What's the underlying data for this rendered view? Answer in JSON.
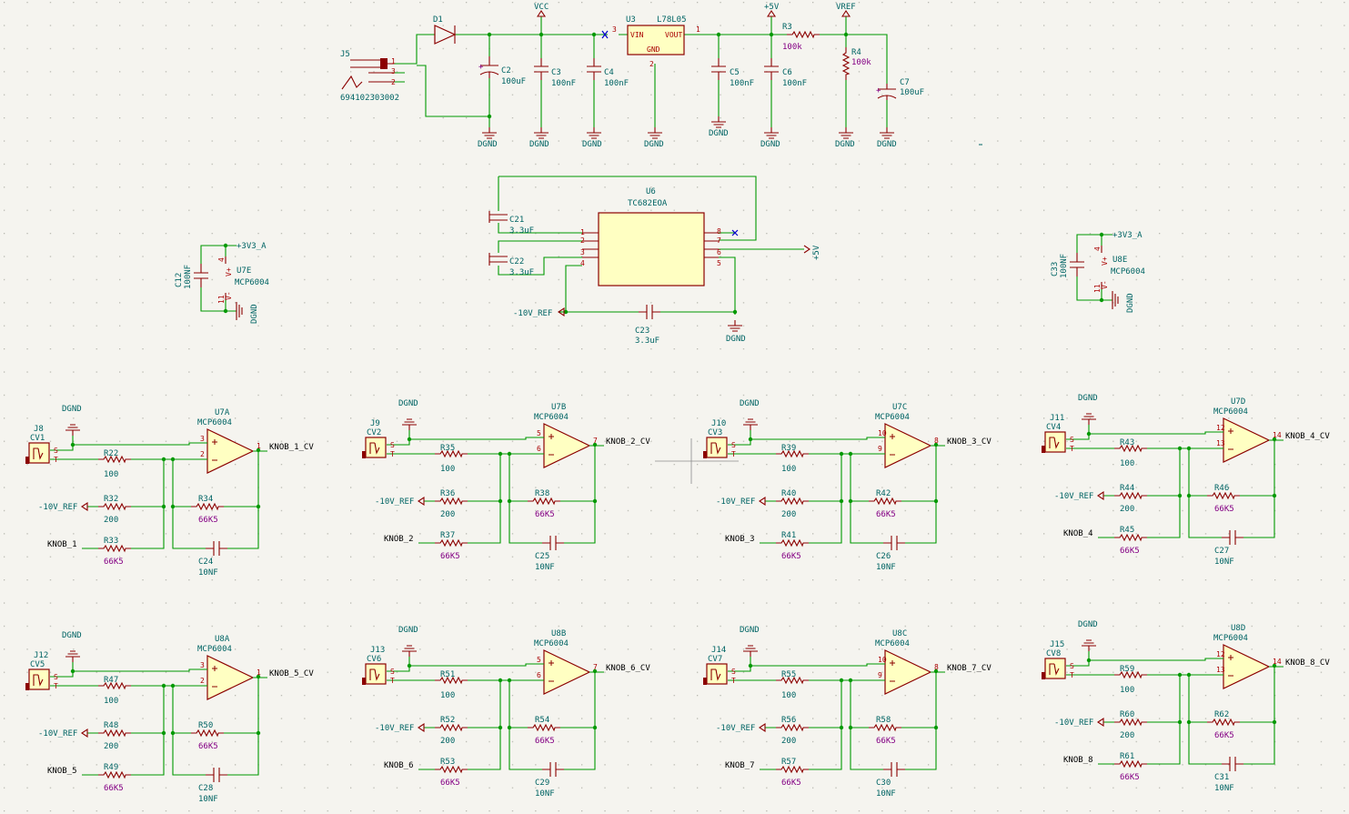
{
  "colors": {
    "wire": "#009900",
    "body": "#8b0000",
    "fill": "#ffffc2",
    "text": "#006464",
    "value": "#840084",
    "pin": "#a90000",
    "bg": "#f5f4ef"
  },
  "power": {
    "jack_ref": "J5",
    "jack_part": "694102303002",
    "jack_pins": [
      "1",
      "3",
      "2"
    ],
    "d1": "D1",
    "vcc": "VCC",
    "p5v": "+5V",
    "vref": "VREF",
    "c2": "C2",
    "c2v": "100uF",
    "c3": "C3",
    "c3v": "100nF",
    "c4": "C4",
    "c4v": "100nF",
    "u3": "U3",
    "u3part": "L78L05",
    "vin": "VIN",
    "vout": "VOUT",
    "gndpin": "GND",
    "pin3": "3",
    "pin1": "1",
    "pin2": "2",
    "c5": "C5",
    "c5v": "100nF",
    "c6": "C6",
    "c6v": "100nF",
    "r3": "R3",
    "r3v": "100k",
    "r4": "R4",
    "r4v": "100k",
    "c7": "C7",
    "c7v": "100uF",
    "gnd": "DGND"
  },
  "u6": {
    "ref": "U6",
    "part": "TC682EOA",
    "c21": "C21",
    "c21v": "3.3uF",
    "c22": "C22",
    "c22v": "3.3uF",
    "c23": "C23",
    "c23v": "3.3uF",
    "neg": "-10V_REF",
    "pos": "+5V",
    "gnd": "DGND",
    "pins_left": [
      "1",
      "2",
      "3",
      "4"
    ],
    "pins_right": [
      "8",
      "7",
      "6",
      "5"
    ]
  },
  "supplies": [
    {
      "cap": "C12",
      "capv": "100NF",
      "ref": "U7E",
      "part": "MCP6004",
      "rail": "+3V3_A",
      "gnd": "DGND",
      "vp": "V+",
      "vm": "V-",
      "p4": "4",
      "p11": "11"
    },
    {
      "cap": "C33",
      "capv": "100NF",
      "ref": "U8E",
      "part": "MCP6004",
      "rail": "+3V3_A",
      "gnd": "DGND",
      "vp": "V+",
      "vm": "V-",
      "p4": "4",
      "p11": "11"
    }
  ],
  "channels": [
    {
      "jack": "J8",
      "jv": "CV1",
      "ra": "R22",
      "rb": "R32",
      "rc": "R33",
      "rf": "R34",
      "cf": "C24",
      "u": "U7A",
      "part": "MCP6004",
      "pp": "3",
      "pn": "2",
      "po": "1",
      "out": "KNOB_1_CV",
      "knob": "KNOB_1"
    },
    {
      "jack": "J9",
      "jv": "CV2",
      "ra": "R35",
      "rb": "R36",
      "rc": "R37",
      "rf": "R38",
      "cf": "C25",
      "u": "U7B",
      "part": "MCP6004",
      "pp": "5",
      "pn": "6",
      "po": "7",
      "out": "KNOB_2_CV",
      "knob": "KNOB_2"
    },
    {
      "jack": "J10",
      "jv": "CV3",
      "ra": "R39",
      "rb": "R40",
      "rc": "R41",
      "rf": "R42",
      "cf": "C26",
      "u": "U7C",
      "part": "MCP6004",
      "pp": "10",
      "pn": "9",
      "po": "8",
      "out": "KNOB_3_CV",
      "knob": "KNOB_3"
    },
    {
      "jack": "J11",
      "jv": "CV4",
      "ra": "R43",
      "rb": "R44",
      "rc": "R45",
      "rf": "R46",
      "cf": "C27",
      "u": "U7D",
      "part": "MCP6004",
      "pp": "12",
      "pn": "13",
      "po": "14",
      "out": "KNOB_4_CV",
      "knob": "KNOB_4"
    },
    {
      "jack": "J12",
      "jv": "CV5",
      "ra": "R47",
      "rb": "R48",
      "rc": "R49",
      "rf": "R50",
      "cf": "C28",
      "u": "U8A",
      "part": "MCP6004",
      "pp": "3",
      "pn": "2",
      "po": "1",
      "out": "KNOB_5_CV",
      "knob": "KNOB_5"
    },
    {
      "jack": "J13",
      "jv": "CV6",
      "ra": "R51",
      "rb": "R52",
      "rc": "R53",
      "rf": "R54",
      "cf": "C29",
      "u": "U8B",
      "part": "MCP6004",
      "pp": "5",
      "pn": "6",
      "po": "7",
      "out": "KNOB_6_CV",
      "knob": "KNOB_6"
    },
    {
      "jack": "J14",
      "jv": "CV7",
      "ra": "R55",
      "rb": "R56",
      "rc": "R57",
      "rf": "R58",
      "cf": "C30",
      "u": "U8C",
      "part": "MCP6004",
      "pp": "10",
      "pn": "9",
      "po": "8",
      "out": "KNOB_7_CV",
      "knob": "KNOB_7"
    },
    {
      "jack": "J15",
      "jv": "CV8",
      "ra": "R59",
      "rb": "R60",
      "rc": "R61",
      "rf": "R62",
      "cf": "C31",
      "u": "U8D",
      "part": "MCP6004",
      "pp": "12",
      "pn": "13",
      "po": "14",
      "out": "KNOB_8_CV",
      "knob": "KNOB_8"
    }
  ],
  "channel_common": {
    "gnd": "DGND",
    "neg": "-10V_REF",
    "s": "S",
    "t": "T",
    "rav": "100",
    "rbv": "200",
    "rcv": "66K5",
    "rfv": "66K5",
    "cfv": "10NF"
  }
}
